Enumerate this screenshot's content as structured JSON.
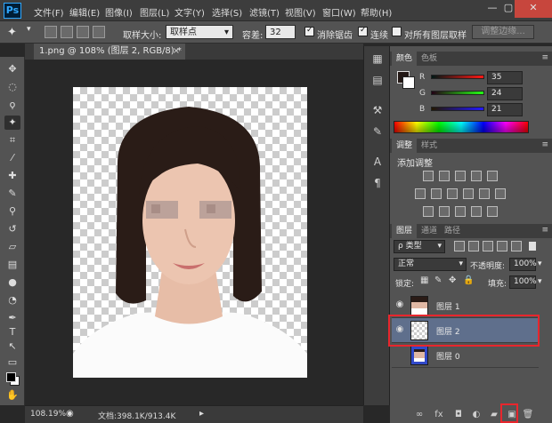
{
  "menubar": {
    "logo": "Ps",
    "items": [
      "文件(F)",
      "编辑(E)",
      "图像(I)",
      "图层(L)",
      "文字(Y)",
      "选择(S)",
      "滤镜(T)",
      "视图(V)",
      "窗口(W)",
      "帮助(H)"
    ],
    "window_controls": {
      "minimize": "—",
      "maximize": "▢",
      "close": "✕"
    }
  },
  "options": {
    "sample_size_label": "取样大小:",
    "sample_size_value": "取样点",
    "tolerance_label": "容差:",
    "tolerance_value": "32",
    "antialias_label": "消除锯齿",
    "antialias_checked": true,
    "contiguous_label": "连续",
    "contiguous_checked": true,
    "all_layers_label": "对所有图层取样",
    "all_layers_checked": false,
    "refine_edge_label": "调整边缘..."
  },
  "document_tab": {
    "title": "1.png @ 108% (图层 2, RGB/8) *",
    "close": "×"
  },
  "tools": [
    {
      "name": "move-tool",
      "glyph": "✥"
    },
    {
      "name": "marquee-tool",
      "glyph": "◌"
    },
    {
      "name": "lasso-tool",
      "glyph": "ϙ"
    },
    {
      "name": "magic-wand-tool",
      "glyph": "✦"
    },
    {
      "name": "crop-tool",
      "glyph": "⌗"
    },
    {
      "name": "eyedropper-tool",
      "glyph": "⁄"
    },
    {
      "name": "healing-brush-tool",
      "glyph": "✚"
    },
    {
      "name": "brush-tool",
      "glyph": "✎"
    },
    {
      "name": "clone-stamp-tool",
      "glyph": "⚲"
    },
    {
      "name": "history-brush-tool",
      "glyph": "↺"
    },
    {
      "name": "eraser-tool",
      "glyph": "▱"
    },
    {
      "name": "gradient-tool",
      "glyph": "▤"
    },
    {
      "name": "blur-tool",
      "glyph": "●"
    },
    {
      "name": "dodge-tool",
      "glyph": "◔"
    },
    {
      "name": "pen-tool",
      "glyph": "✒"
    },
    {
      "name": "type-tool",
      "glyph": "T"
    },
    {
      "name": "path-selection-tool",
      "glyph": "↖"
    },
    {
      "name": "rectangle-tool",
      "glyph": "▭"
    },
    {
      "name": "hand-tool",
      "glyph": "✋"
    },
    {
      "name": "zoom-tool",
      "glyph": "⚲"
    }
  ],
  "status": {
    "zoom": "108.19%",
    "doc_info": "文档:398.1K/913.4K"
  },
  "color_panel": {
    "tabs": [
      "颜色",
      "色板"
    ],
    "r_label": "R",
    "g_label": "G",
    "b_label": "B",
    "r_value": "35",
    "g_value": "24",
    "b_value": "21",
    "fg_color": "#231815"
  },
  "adjustments_panel": {
    "tabs": [
      "调整",
      "样式"
    ],
    "add_label": "添加调整"
  },
  "layers_panel": {
    "tabs": [
      "图层",
      "通道",
      "路径"
    ],
    "filter_label": "ρ 类型",
    "blend_mode": "正常",
    "opacity_label": "不透明度:",
    "opacity_value": "100%",
    "lock_label": "锁定:",
    "fill_label": "填充:",
    "fill_value": "100%",
    "layers": [
      {
        "name": "图层 1",
        "visible": true,
        "selected": false
      },
      {
        "name": "图层 2",
        "visible": true,
        "selected": true
      },
      {
        "name": "图层 0",
        "visible": false,
        "selected": false
      }
    ],
    "footer_icons": [
      "link-icon",
      "fx-icon",
      "mask-icon",
      "adjustment-layer-icon",
      "group-folder-icon",
      "new-layer-icon",
      "trash-icon"
    ],
    "footer_glyphs": [
      "∞",
      "fx",
      "◘",
      "◐",
      "▰",
      "▣",
      "🗑"
    ]
  },
  "colors": {
    "selection_highlight": "#e8262d",
    "selected_layer_bg": "#5f6f8c",
    "ps_accent": "#31a8ff"
  }
}
